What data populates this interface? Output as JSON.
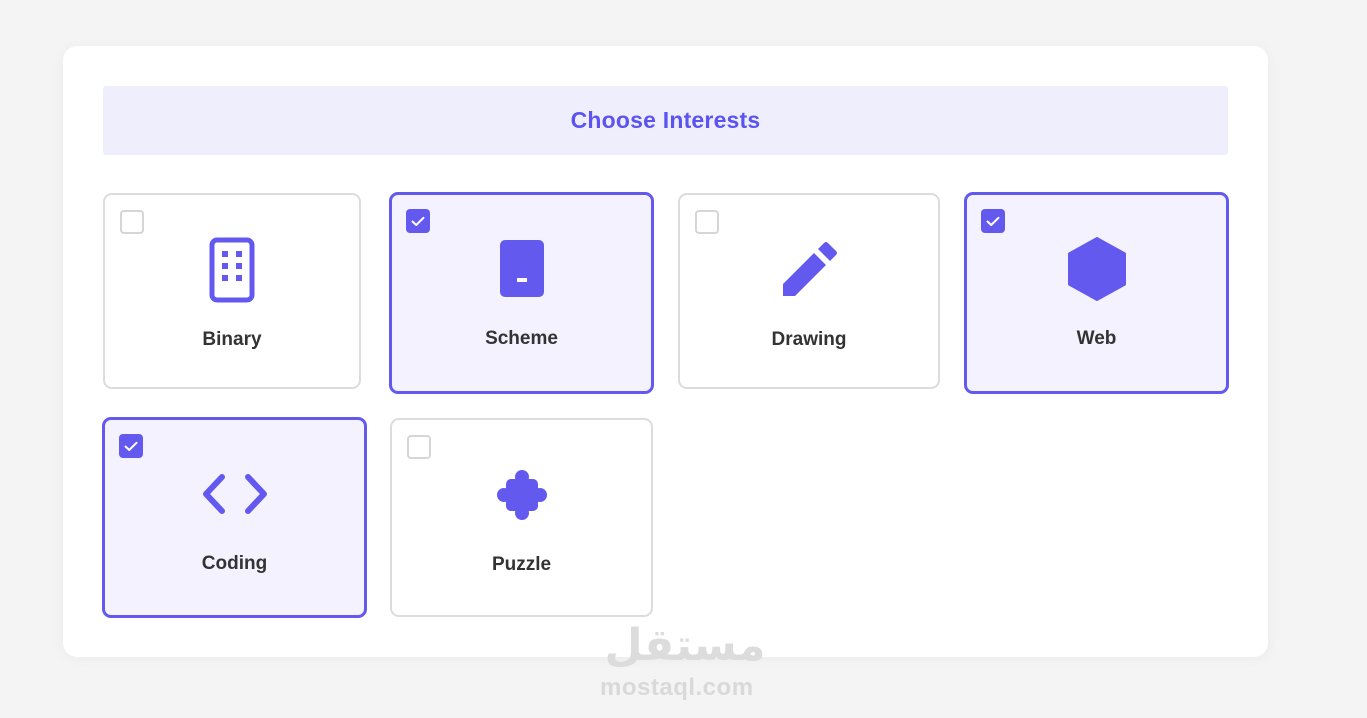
{
  "header": {
    "title": "Choose Interests"
  },
  "accent_color": "#6459ee",
  "interests": [
    {
      "label": "Binary",
      "icon": "building-icon",
      "checked": false
    },
    {
      "label": "Scheme",
      "icon": "tablet-icon",
      "checked": true
    },
    {
      "label": "Drawing",
      "icon": "pencil-icon",
      "checked": false
    },
    {
      "label": "Web",
      "icon": "hexagon-icon",
      "checked": true
    },
    {
      "label": "Coding",
      "icon": "code-icon",
      "checked": true
    },
    {
      "label": "Puzzle",
      "icon": "puzzle-icon",
      "checked": false
    }
  ],
  "watermark": {
    "text": "mostaql.com",
    "logo": "مستقل"
  }
}
